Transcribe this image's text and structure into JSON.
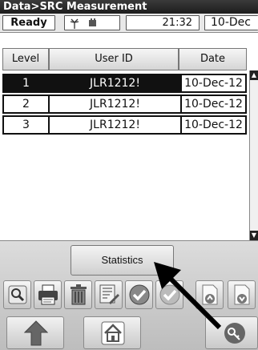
{
  "window": {
    "title": "Data>SRC Measurement"
  },
  "status": {
    "ready": "Ready",
    "time": "21:32",
    "date": "10-Dec"
  },
  "table": {
    "headers": {
      "level": "Level",
      "user_id": "User ID",
      "date": "Date"
    },
    "rows": [
      {
        "level": "1",
        "user_id": "JLR1212!",
        "date": "10-Dec-12"
      },
      {
        "level": "2",
        "user_id": "JLR1212!",
        "date": "10-Dec-12"
      },
      {
        "level": "3",
        "user_id": "JLR1212!",
        "date": "10-Dec-12"
      }
    ]
  },
  "buttons": {
    "statistics": "Statistics"
  },
  "toolbar": {
    "icons": [
      "magnifier-icon",
      "printer-icon",
      "trash-icon",
      "edit-document-icon",
      "checkmark-icon",
      "checkmark-disabled-icon",
      "page-up-icon",
      "page-down-icon"
    ]
  },
  "nav": {
    "icons": [
      "up-arrow-icon",
      "home-icon",
      "key-icon"
    ]
  }
}
